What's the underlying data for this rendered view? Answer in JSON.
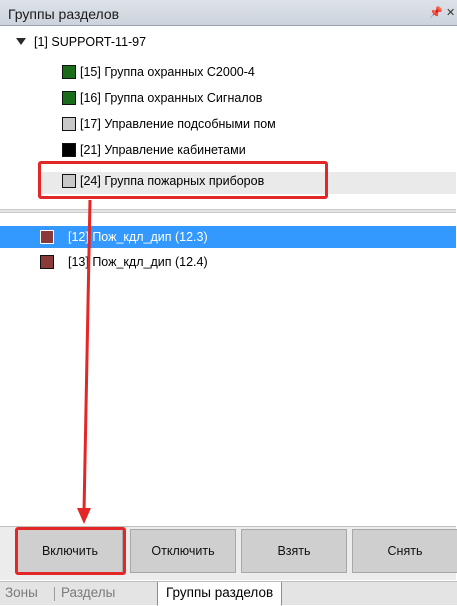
{
  "panel": {
    "title": "Группы разделов",
    "pin_icon": "pin-icon",
    "close_icon": "close-icon"
  },
  "tree": {
    "root_label": "[1] SUPPORT-11-97",
    "items": [
      {
        "label": "[15] Группа охранных С2000-4",
        "color": "#1a6b1a"
      },
      {
        "label": "[16] Группа охранных Сигналов",
        "color": "#1a6b1a"
      },
      {
        "label": "[17] Управление подсобными пом",
        "color": "#c8c8c8"
      },
      {
        "label": "[21] Управление кабинетами",
        "color": "#000000"
      },
      {
        "label": "[24] Группа пожарных приборов",
        "color": "#c8c8c8"
      }
    ]
  },
  "zones": {
    "items": [
      {
        "label": "[12] Пож_кдл_дип (12.3)",
        "color": "#8b3a3a",
        "selected": true
      },
      {
        "label": "[13] Пож_кдл_дип (12.4)",
        "color": "#8b3a3a",
        "selected": false
      }
    ]
  },
  "buttons": {
    "enable": "Включить",
    "disable": "Отключить",
    "arm": "Взять",
    "disarm": "Снять"
  },
  "tabs": {
    "zones": "Зоны",
    "sections": "Разделы",
    "section_groups": "Группы разделов"
  },
  "annotation": {
    "color": "#e32626"
  }
}
